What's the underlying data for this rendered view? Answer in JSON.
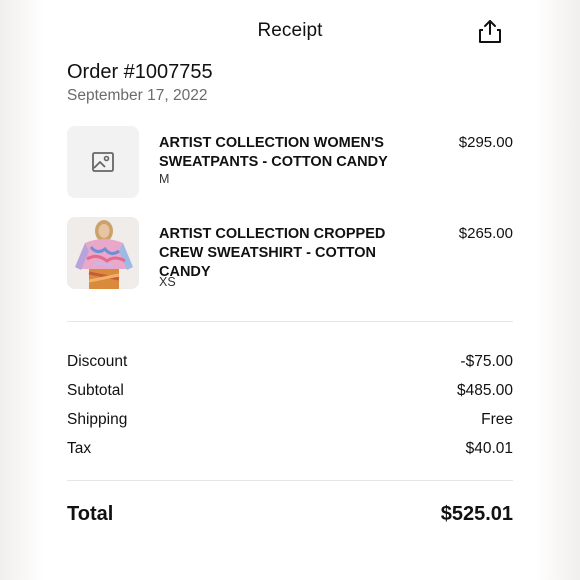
{
  "header": {
    "title": "Receipt",
    "share_icon": "share-icon"
  },
  "order": {
    "number": "Order #1007755",
    "date": "September 17, 2022"
  },
  "items": [
    {
      "name": "ARTIST COLLECTION WOMEN'S SWEATPANTS - COTTON CANDY",
      "size": "M",
      "price": "$295.00",
      "thumbnail": "image-placeholder-icon"
    },
    {
      "name": "ARTIST COLLECTION CROPPED CREW SWEATSHIRT - COTTON CANDY",
      "size": "XS",
      "price": "$265.00",
      "thumbnail": "product-photo"
    }
  ],
  "summary": {
    "discount_label": "Discount",
    "discount_value": "-$75.00",
    "subtotal_label": "Subtotal",
    "subtotal_value": "$485.00",
    "shipping_label": "Shipping",
    "shipping_value": "Free",
    "tax_label": "Tax",
    "tax_value": "$40.01"
  },
  "total": {
    "label": "Total",
    "value": "$525.01"
  },
  "colors": {
    "text": "#111111",
    "muted": "#6b6b6b",
    "divider": "#e6e6e6",
    "thumb_bg": "#f2f2f2"
  }
}
